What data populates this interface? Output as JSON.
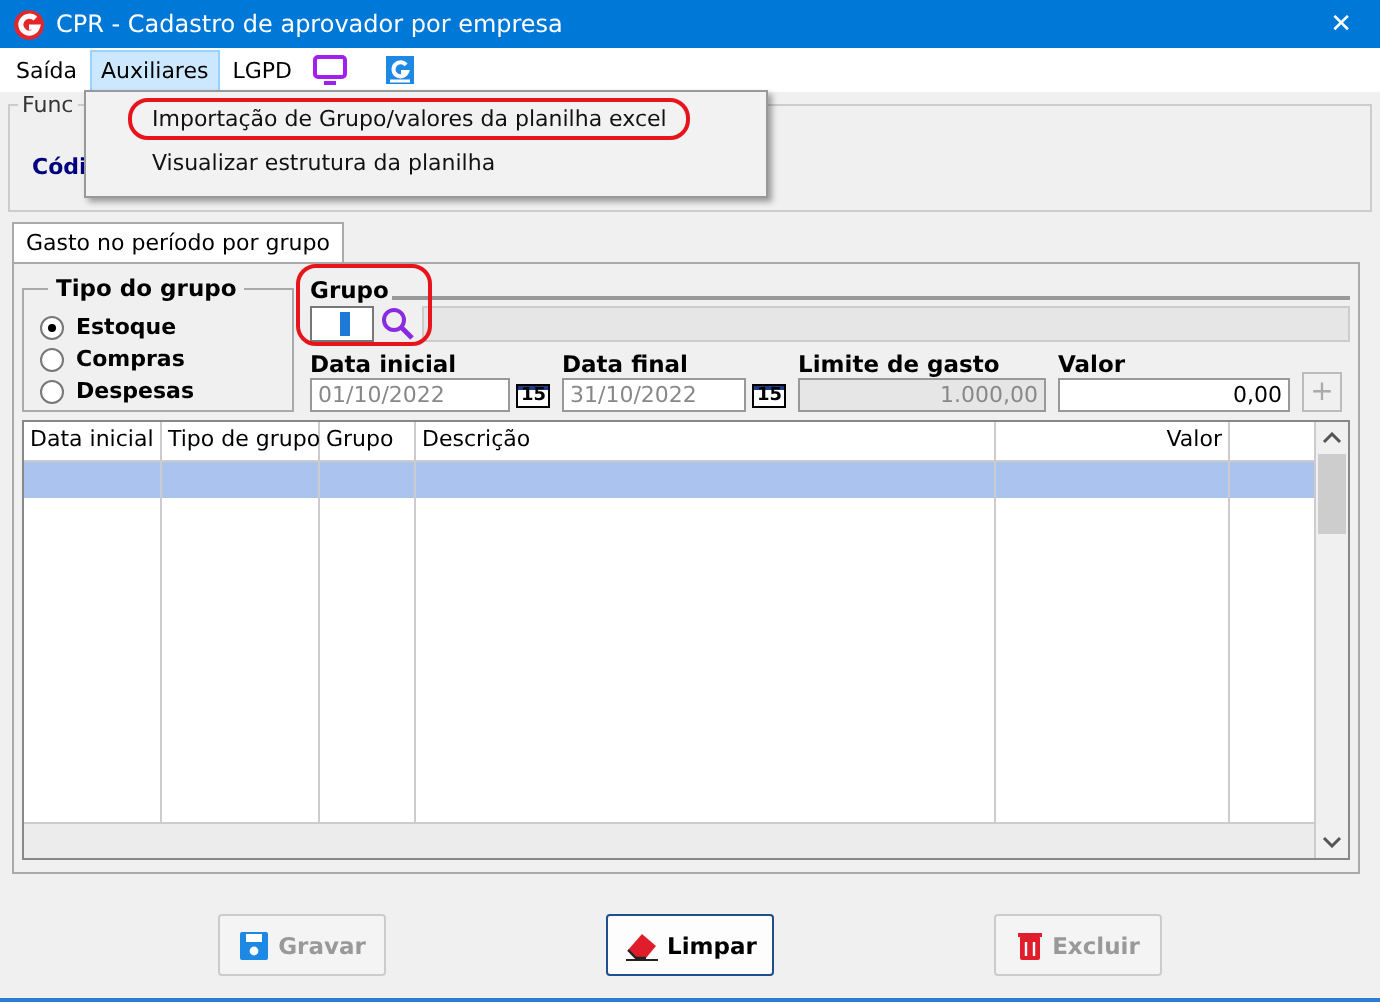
{
  "window": {
    "title": "CPR - Cadastro de aprovador por empresa",
    "close": "✕"
  },
  "menu": [
    {
      "label": "Saída",
      "selected": false
    },
    {
      "label": "Auxiliares",
      "selected": true
    },
    {
      "label": "LGPD",
      "selected": false
    }
  ],
  "dropdown": [
    {
      "label": "Importação de Grupo/valores da planilha excel",
      "highlighted": true
    },
    {
      "label": "Visualizar estrutura da planilha",
      "highlighted": false
    }
  ],
  "top_group": {
    "title": "Func",
    "field_label": "Códi"
  },
  "tabs": [
    {
      "label": "Gasto no período por grupo",
      "selected": true
    }
  ],
  "tipo_grupo": {
    "title": "Tipo do grupo",
    "options": [
      {
        "label": "Estoque",
        "selected": true
      },
      {
        "label": "Compras",
        "selected": false
      },
      {
        "label": "Despesas",
        "selected": false
      }
    ]
  },
  "grupo": {
    "label": "Grupo",
    "highlighted": true
  },
  "fields": [
    {
      "kind": "date",
      "label": "Data inicial",
      "value": "01/10/2022",
      "disabled": true,
      "button": "15"
    },
    {
      "kind": "date",
      "label": "Data final",
      "value": "31/10/2022",
      "disabled": true,
      "button": "15"
    },
    {
      "kind": "number",
      "label": "Limite de gasto",
      "value": "1.000,00",
      "disabled": true
    },
    {
      "kind": "number",
      "label": "Valor",
      "value": "0,00",
      "disabled": false
    }
  ],
  "add_button": {
    "label": "+",
    "disabled": true
  },
  "table": {
    "columns": [
      "Data inicial",
      "Tipo de grupo",
      "Grupo",
      "Descrição",
      "Valor"
    ],
    "rows": [
      {
        "selected": true
      }
    ]
  },
  "buttons": [
    {
      "kind": "save",
      "label": "Gravar",
      "disabled": true
    },
    {
      "kind": "clear",
      "label": "Limpar",
      "disabled": false
    },
    {
      "kind": "delete",
      "label": "Excluir",
      "disabled": true
    }
  ]
}
